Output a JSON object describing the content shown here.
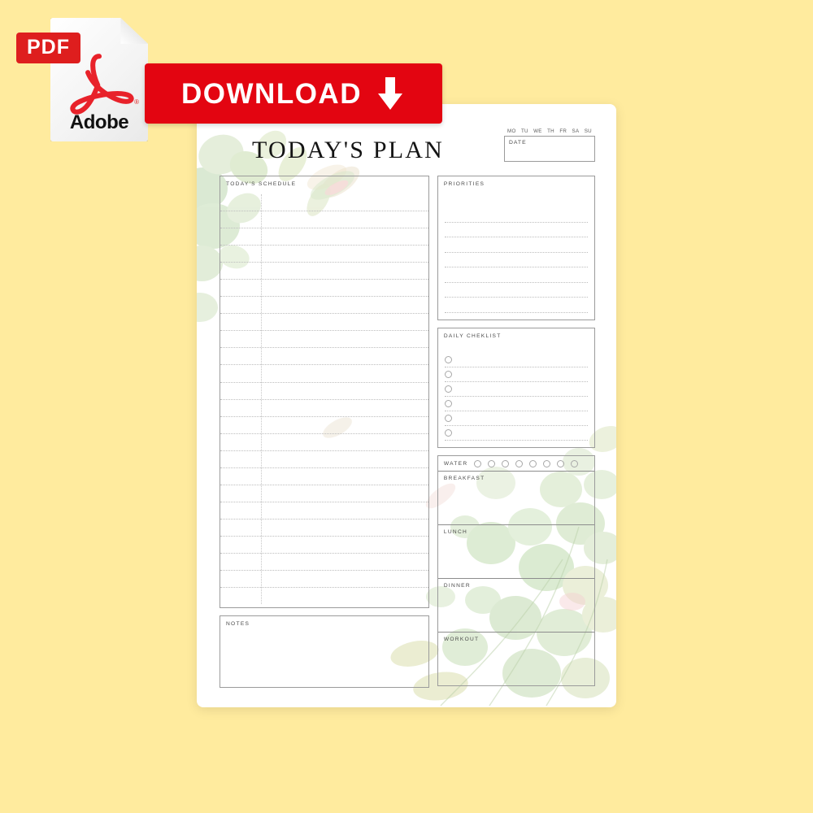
{
  "overlay": {
    "pdf_icon": {
      "badge_label": "PDF",
      "brand_label": "Adobe",
      "registered_mark": "®",
      "icon_name": "adobe-pdf-file-icon"
    },
    "download_button": {
      "label": "DOWNLOAD",
      "arrow_icon": "download-arrow-icon",
      "bg_color": "#E30511",
      "text_color": "#FFFFFF"
    }
  },
  "background": {
    "colors": {
      "pink": "#FFA8BE",
      "light_blue": "#A9E4F2",
      "cyan": "#00CCDF",
      "yellow": "#FFEB9E"
    }
  },
  "page": {
    "title": "TODAY'S PLAN",
    "date_header": {
      "days": [
        "MO",
        "TU",
        "WE",
        "TH",
        "FR",
        "SA",
        "SU"
      ],
      "date_label": "DATE"
    },
    "schedule": {
      "label": "TODAY'S SCHEDULE",
      "row_count": 24
    },
    "notes": {
      "label": "NOTES"
    },
    "priorities": {
      "label": "PRIORITIES",
      "line_count": 7
    },
    "checklist": {
      "label": "DAILY CHEKLIST",
      "item_count": 6
    },
    "water": {
      "label": "WATER",
      "glass_count": 8
    },
    "meals": [
      {
        "label": "BREAKFAST"
      },
      {
        "label": "LUNCH"
      },
      {
        "label": "DINNER"
      },
      {
        "label": "WORKOUT"
      }
    ]
  }
}
